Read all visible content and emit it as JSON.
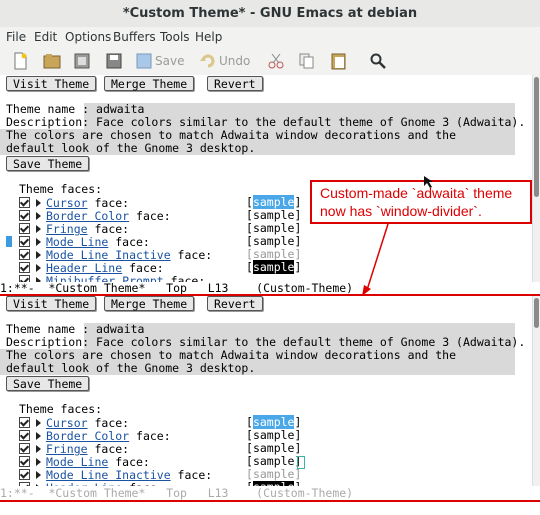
{
  "window": {
    "title": "*Custom Theme* - GNU Emacs at debian"
  },
  "menu": [
    "File",
    "Edit",
    "Options",
    "Buffers",
    "Tools",
    "Help"
  ],
  "toolbar": {
    "save_label": "Save",
    "undo_label": "Undo",
    "icons": [
      "new-file-icon",
      "open-folder-icon",
      "close-buffer-icon",
      "save-icon",
      "undo-icon",
      "cut-icon",
      "copy-icon",
      "paste-icon",
      "search-icon"
    ]
  },
  "buffer": {
    "buttons": {
      "visit": "Visit Theme",
      "merge": "Merge Theme",
      "revert": "Revert",
      "save_theme": "Save Theme"
    },
    "theme_name_label": "Theme name : ",
    "theme_name_value": "adwaita",
    "description_label": "Description: ",
    "description_lines": [
      "Face colors similar to the default theme of Gnome 3 (Adwaita).",
      "The colors are chosen to match Adwaita window decorations and the",
      "default look of the Gnome 3 desktop."
    ],
    "faces_header": "Theme faces:",
    "faces": [
      {
        "name": "Cursor",
        "suffix": " face:"
      },
      {
        "name": "Border Color",
        "suffix": " face:"
      },
      {
        "name": "Fringe",
        "suffix": " face:"
      },
      {
        "name": "Mode Line",
        "suffix": " face:"
      },
      {
        "name": "Mode Line Inactive",
        "suffix": " face:"
      },
      {
        "name": "Header Line",
        "suffix": " face:"
      },
      {
        "name": "Minibuffer Prompt",
        "suffix": " face:"
      }
    ],
    "sample_text": "sample"
  },
  "modeline_top": "1:**-  *Custom Theme*   Top   L13    (Custom-Theme)",
  "modeline_bottom": "1:**-  *Custom Theme*   Top   L13    (Custom-Theme)",
  "annotation": "Custom-made `adwaita` theme now has `window-divider`.",
  "colors": {
    "divider": "#dd0000",
    "link": "#1b53a3",
    "cursor_sample": "#4aa8e8"
  }
}
